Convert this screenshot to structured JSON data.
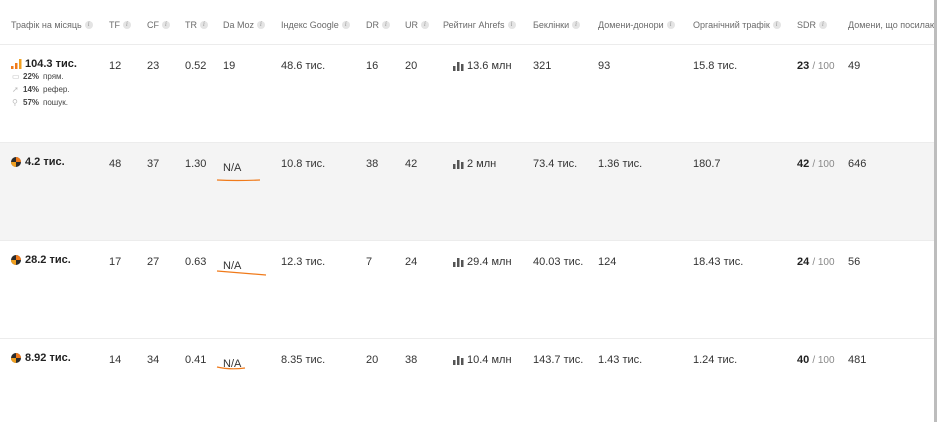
{
  "header": {
    "traffic": "Трафік на місяць",
    "tf": "TF",
    "cf": "CF",
    "tr": "TR",
    "damoz": "Da Moz",
    "google_index": "Індекс Google",
    "dr": "DR",
    "ur": "UR",
    "ahrefs_rank": "Рейтинг Ahrefs",
    "backlinks": "Беклінки",
    "donor_domains": "Домени-донори",
    "organic": "Органічний трафік",
    "sdr": "SDR",
    "linking_domains": "Домени, що посилаю"
  },
  "rows": [
    {
      "traffic": "104.3 тис.",
      "sources": [
        {
          "pct": "22%",
          "label": "прям.",
          "icon": "direct-icon"
        },
        {
          "pct": "14%",
          "label": "рефер.",
          "icon": "link-icon"
        },
        {
          "pct": "57%",
          "label": "пошук.",
          "icon": "search-icon"
        }
      ],
      "tf": "12",
      "cf": "23",
      "tr": "0.52",
      "damoz": "19",
      "google_index": "48.6 тис.",
      "dr": "16",
      "ur": "20",
      "ahrefs_rank": "13.6 млн",
      "backlinks": "321",
      "donor_domains": "93",
      "organic": "15.8 тис.",
      "sdr": "23",
      "sdr_of": "/ 100",
      "linking_domains": "49"
    },
    {
      "traffic": "4.2 тис.",
      "tf": "48",
      "cf": "37",
      "tr": "1.30",
      "damoz": "N/A",
      "google_index": "10.8 тис.",
      "dr": "38",
      "ur": "42",
      "ahrefs_rank": "2 млн",
      "backlinks": "73.4 тис.",
      "donor_domains": "1.36 тис.",
      "organic": "180.7",
      "sdr": "42",
      "sdr_of": "/ 100",
      "linking_domains": "646"
    },
    {
      "traffic": "28.2 тис.",
      "tf": "17",
      "cf": "27",
      "tr": "0.63",
      "damoz": "N/A",
      "google_index": "12.3 тис.",
      "dr": "7",
      "ur": "24",
      "ahrefs_rank": "29.4 млн",
      "backlinks": "40.03 тис.",
      "donor_domains": "124",
      "organic": "18.43 тис.",
      "sdr": "24",
      "sdr_of": "/ 100",
      "linking_domains": "56"
    },
    {
      "traffic": "8.92 тис.",
      "tf": "14",
      "cf": "34",
      "tr": "0.41",
      "damoz": "N/A",
      "google_index": "8.35 тис.",
      "dr": "20",
      "ur": "38",
      "ahrefs_rank": "10.4 млн",
      "backlinks": "143.7 тис.",
      "donor_domains": "1.43 тис.",
      "organic": "1.24 тис.",
      "sdr": "40",
      "sdr_of": "/ 100",
      "linking_domains": "481"
    }
  ],
  "colors": {
    "accent_orange": "#f07a1a",
    "bar_icon": "#555555",
    "logo_dark": "#2b2b2b"
  }
}
